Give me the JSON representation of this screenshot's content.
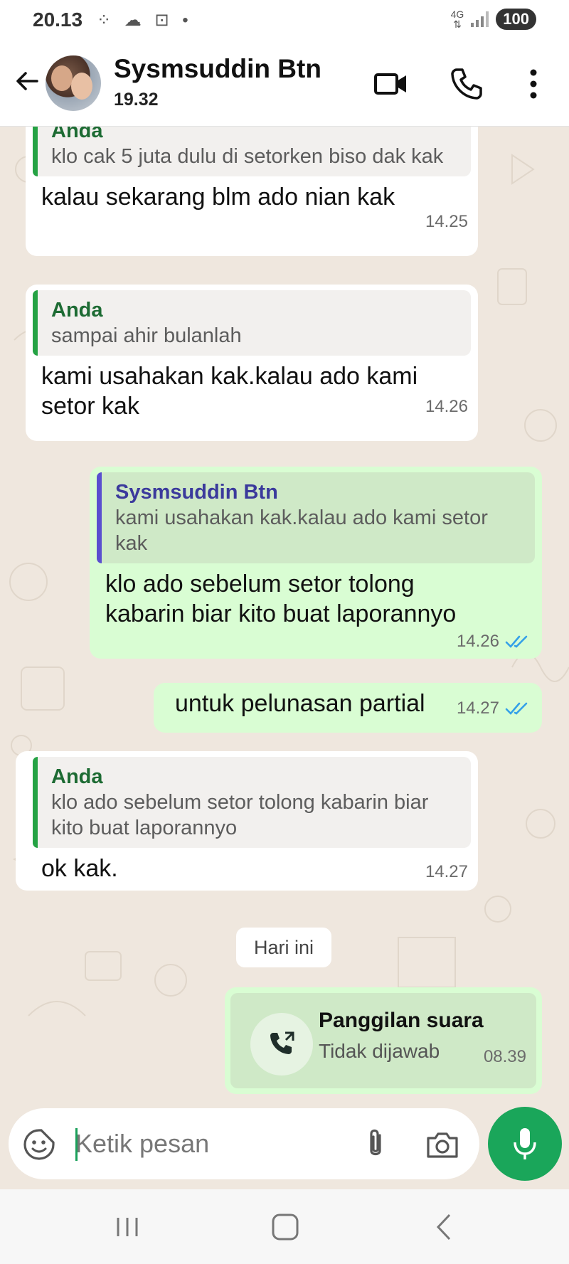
{
  "status_bar": {
    "time": "20.13",
    "icons": "⁘ ☁ ⊡ •",
    "signal": "4G",
    "battery": "100"
  },
  "header": {
    "contact_name": "Sysmsuddin Btn",
    "last_seen": "19.32"
  },
  "messages": [
    {
      "direction": "in",
      "quote_author": "Anda",
      "quote_text": "klo cak 5 juta dulu di setorken biso dak kak",
      "text": "kalau sekarang blm ado nian kak",
      "time": "14.25"
    },
    {
      "direction": "in",
      "quote_author": "Anda",
      "quote_text": "sampai ahir bulanlah",
      "text": "kami usahakan kak.kalau ado kami setor kak",
      "time": "14.26"
    },
    {
      "direction": "out",
      "quote_author": "Sysmsuddin Btn",
      "quote_text": "kami usahakan kak.kalau ado kami setor kak",
      "text": "klo ado sebelum setor tolong kabarin biar kito buat laporannyo",
      "time": "14.26"
    },
    {
      "direction": "out",
      "text": "untuk pelunasan partial",
      "time": "14.27"
    },
    {
      "direction": "in",
      "quote_author": "Anda",
      "quote_text": "klo ado sebelum setor tolong kabarin biar kito buat laporannyo",
      "text": "ok kak.",
      "time": "14.27"
    }
  ],
  "day_separator": "Hari ini",
  "call": {
    "title": "Panggilan suara",
    "status": "Tidak dijawab",
    "time": "08.39"
  },
  "composer": {
    "placeholder": "Ketik pesan"
  },
  "colors": {
    "accent": "#1aa65a",
    "outgoing_bubble": "#d9fdd3",
    "incoming_bubble": "#ffffff",
    "chat_background": "#efe7de",
    "read_tick": "#34a0e8"
  }
}
